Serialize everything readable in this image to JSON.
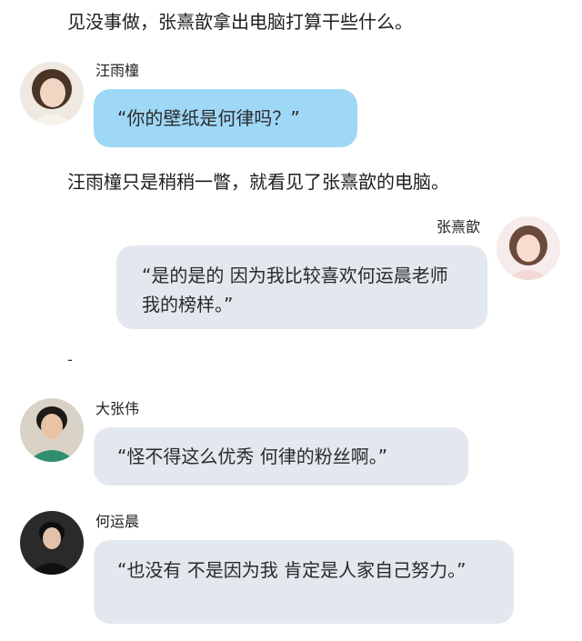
{
  "narration": {
    "line1": "见没事做，张熹歆拿出电脑打算干些什么。",
    "line2": "汪雨橦只是稍稍一瞥，就看见了张熹歆的电脑。"
  },
  "messages": [
    {
      "name": "汪雨橦",
      "text": "“你的壁纸是何律吗？”",
      "style": "blue",
      "side": "left"
    },
    {
      "name": "张熹歆",
      "text": "“是的是的 因为我比较喜欢何运晨老师 我的榜样。”",
      "style": "gray",
      "side": "right"
    },
    {
      "name": "大张伟",
      "text": "“怪不得这么优秀 何律的粉丝啊。”",
      "style": "gray",
      "side": "left"
    },
    {
      "name": "何运晨",
      "text": "“也没有 不是因为我 肯定是人家自己努力。”",
      "style": "gray",
      "side": "left"
    }
  ],
  "divider": "-",
  "colors": {
    "bubble_blue": "#9fd8f7",
    "bubble_gray": "#e3e7ee"
  }
}
